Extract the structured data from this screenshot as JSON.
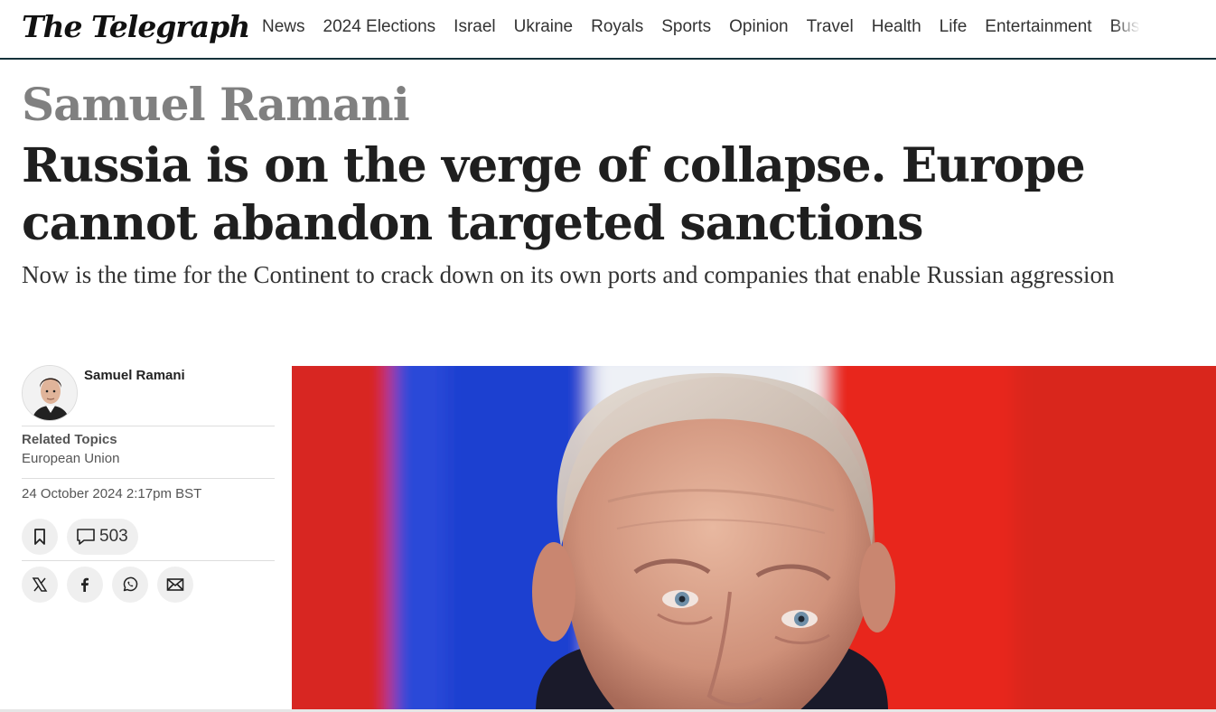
{
  "brand": {
    "logo": "The Telegraph"
  },
  "nav": {
    "items": [
      "News",
      "2024 Elections",
      "Israel",
      "Ukraine",
      "Royals",
      "Sports",
      "Opinion",
      "Travel",
      "Health",
      "Life",
      "Entertainment",
      "Busi"
    ]
  },
  "article": {
    "kicker": "Samuel Ramani",
    "headline": "Russia is on the verge of collapse. Europe cannot abandon targeted sanctions",
    "standfirst": "Now is the time for the Continent to crack down on its own ports and companies that enable Russian aggression"
  },
  "meta": {
    "author": "Samuel Ramani",
    "related_label": "Related Topics",
    "related_topic": "European Union",
    "date": "24 October 2024 2:17pm BST",
    "comment_count": "503"
  },
  "icons": {
    "bookmark": "bookmark-icon",
    "comment": "comment-icon",
    "x": "x-icon",
    "facebook": "facebook-icon",
    "whatsapp": "whatsapp-icon",
    "email": "email-icon"
  },
  "colors": {
    "header_rule": "#15323a",
    "kicker": "#808080",
    "flag_blue": "#1d3fd0",
    "flag_red": "#e8271f"
  }
}
